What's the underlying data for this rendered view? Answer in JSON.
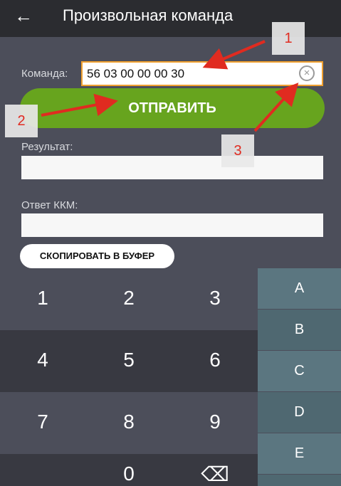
{
  "appbar": {
    "back_icon": "arrow-left-icon",
    "title": "Произвольная команда"
  },
  "form": {
    "command_label": "Команда:",
    "command_value": "56 03 00 00 00 30",
    "clear_icon": "clear-circle-icon",
    "send_label": "ОТПРАВИТЬ",
    "result_label": "Результат:",
    "result_value": "",
    "kkm_label": "Ответ ККМ:",
    "kkm_value": "",
    "copy_label": "СКОПИРОВАТЬ В БУФЕР"
  },
  "keypad": {
    "digits": [
      "1",
      "2",
      "3",
      "4",
      "5",
      "6",
      "7",
      "8",
      "9",
      "0"
    ],
    "backspace_icon": "backspace-icon",
    "hex": [
      "A",
      "B",
      "C",
      "D",
      "E"
    ]
  },
  "annotations": {
    "markers": [
      "1",
      "2",
      "3"
    ],
    "arrow_color": "#e02b20"
  },
  "colors": {
    "accent_green": "#67a41e",
    "focus_border": "#f0a030",
    "hex_key": "#5b7680"
  }
}
